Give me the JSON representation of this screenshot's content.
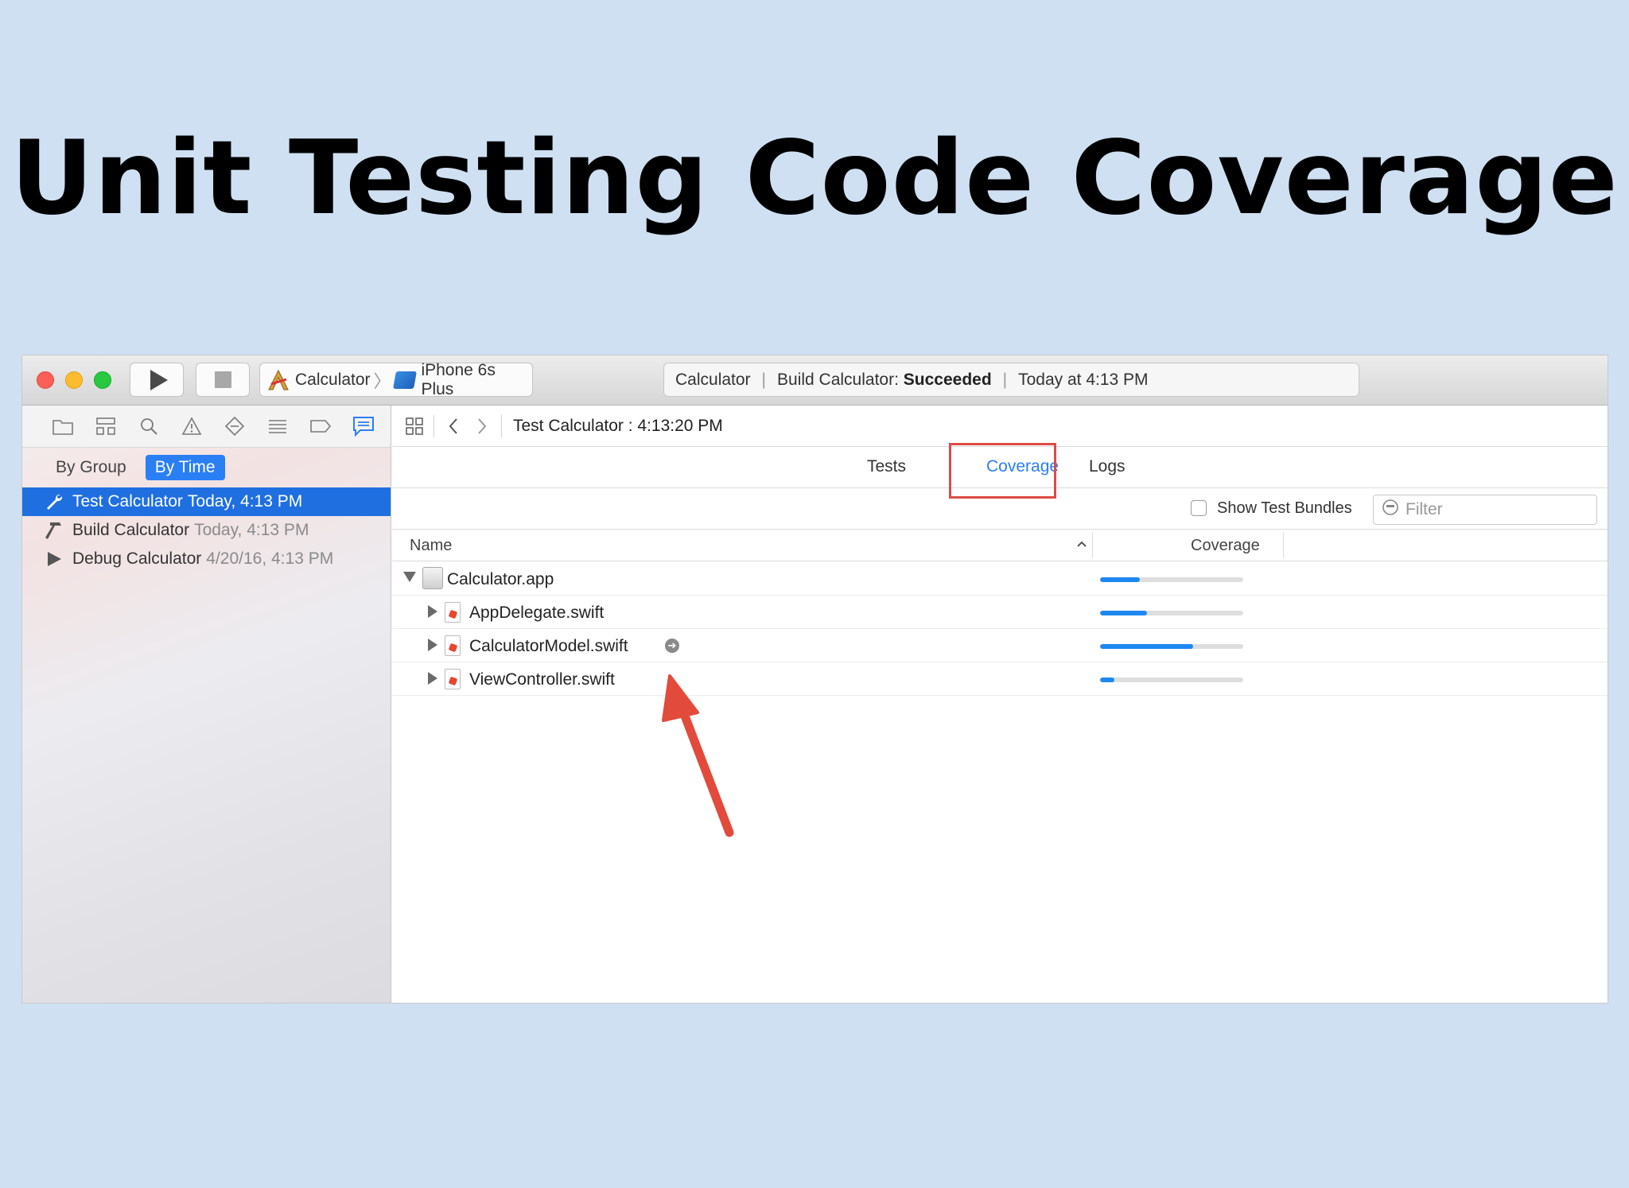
{
  "headline": "Unit Testing Code Coverage",
  "toolbar": {
    "scheme_name": "Calculator",
    "device_name": "iPhone 6s Plus",
    "activity_project": "Calculator",
    "activity_prefix": "Build Calculator:",
    "activity_status": "Succeeded",
    "activity_time": "Today at 4:13 PM"
  },
  "sidebar": {
    "segments": [
      "By Group",
      "By Time"
    ],
    "active_segment": "By Time",
    "logs": [
      {
        "title": "Test Calculator",
        "time": "Today, 4:13 PM",
        "icon": "wrench-icon",
        "selected": true
      },
      {
        "title": "Build Calculator",
        "time": "Today, 4:13 PM",
        "icon": "hammer-icon",
        "selected": false
      },
      {
        "title": "Debug Calculator",
        "time": "4/20/16, 4:13 PM",
        "icon": "play-icon",
        "selected": false
      }
    ]
  },
  "main": {
    "jump_title": "Test Calculator : 4:13:20 PM",
    "tabs": [
      "Tests",
      "Coverage",
      "Logs"
    ],
    "active_tab": "Coverage",
    "show_test_bundles_label": "Show Test Bundles",
    "filter_placeholder": "Filter",
    "columns": {
      "name": "Name",
      "coverage": "Coverage"
    },
    "rows": [
      {
        "name": "Calculator.app",
        "coverage": 0.28,
        "level": 0,
        "expanded": true
      },
      {
        "name": "AppDelegate.swift",
        "coverage": 0.33,
        "level": 1,
        "expanded": false
      },
      {
        "name": "CalculatorModel.swift",
        "coverage": 0.65,
        "level": 1,
        "expanded": false,
        "goto": true
      },
      {
        "name": "ViewController.swift",
        "coverage": 0.1,
        "level": 1,
        "expanded": false
      }
    ]
  },
  "colors": {
    "accent": "#2b7ff5",
    "highlight": "#de4b45",
    "coverage_bar": "#1e88f0",
    "background": "#cfe0f2"
  }
}
